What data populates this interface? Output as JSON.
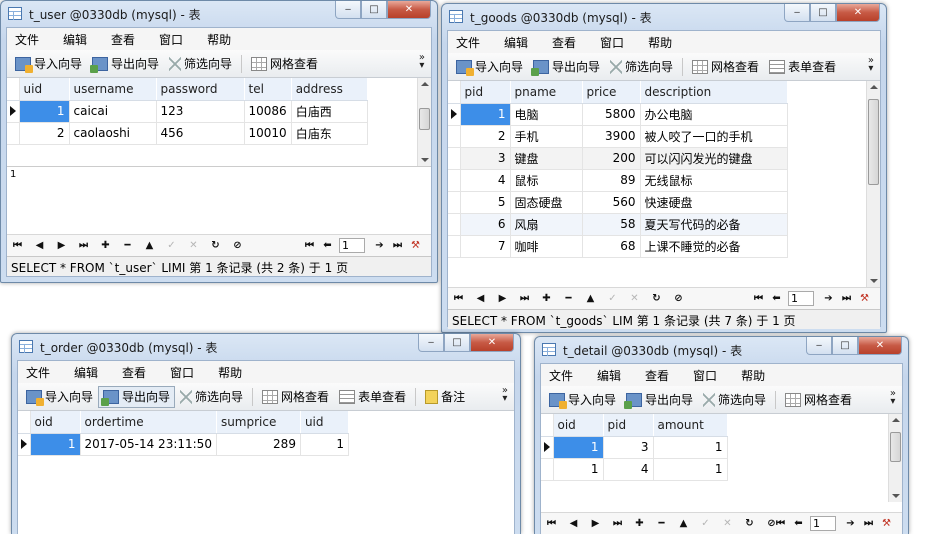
{
  "menu": [
    "文件",
    "编辑",
    "查看",
    "窗口",
    "帮助"
  ],
  "toolbar": {
    "import": "导入向导",
    "export": "导出向导",
    "filter": "筛选向导",
    "grid": "网格查看",
    "form": "表单查看",
    "memo": "备注"
  },
  "windows": {
    "user": {
      "title": "t_user @0330db (mysql) - 表",
      "columns": [
        "uid",
        "username",
        "password",
        "tel",
        "address"
      ],
      "rows": [
        [
          "1",
          "caicai",
          "123",
          "10086",
          "白庙西"
        ],
        [
          "2",
          "caolaoshi",
          "456",
          "10010",
          "白庙东"
        ]
      ],
      "memo_text": "1",
      "page": "1",
      "status": "SELECT * FROM `t_user` LIMI 第 1 条记录 (共 2 条) 于 1 页"
    },
    "goods": {
      "title": "t_goods @0330db (mysql) - 表",
      "columns": [
        "pid",
        "pname",
        "price",
        "description"
      ],
      "rows": [
        [
          "1",
          "电脑",
          "5800",
          "办公电脑"
        ],
        [
          "2",
          "手机",
          "3900",
          "被人咬了一口的手机"
        ],
        [
          "3",
          "键盘",
          "200",
          "可以闪闪发光的键盘"
        ],
        [
          "4",
          "鼠标",
          "89",
          "无线鼠标"
        ],
        [
          "5",
          "固态硬盘",
          "560",
          "快速硬盘"
        ],
        [
          "6",
          "风扇",
          "58",
          "夏天写代码的必备"
        ],
        [
          "7",
          "咖啡",
          "68",
          "上课不睡觉的必备"
        ]
      ],
      "page": "1",
      "status": "SELECT * FROM `t_goods` LIM 第 1 条记录 (共 7 条) 于 1 页"
    },
    "order": {
      "title": "t_order @0330db (mysql) - 表",
      "columns": [
        "oid",
        "ordertime",
        "sumprice",
        "uid"
      ],
      "rows": [
        [
          "1",
          "2017-05-14 23:11:50",
          "289",
          "1"
        ]
      ]
    },
    "detail": {
      "title": "t_detail @0330db (mysql) - 表",
      "columns": [
        "oid",
        "pid",
        "amount"
      ],
      "rows": [
        [
          "1",
          "3",
          "1"
        ],
        [
          "1",
          "4",
          "1"
        ]
      ],
      "page": "1"
    }
  }
}
